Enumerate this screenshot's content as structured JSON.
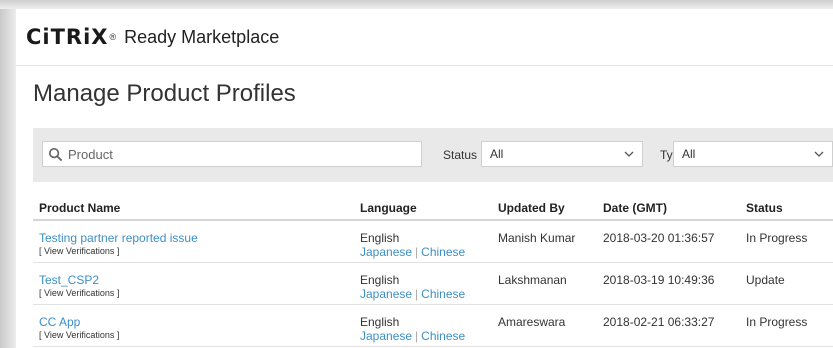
{
  "brand": {
    "logo_mark": "CiTRiX",
    "logo_sup": "®",
    "product": "Ready Marketplace"
  },
  "page": {
    "title": "Manage Product Profiles"
  },
  "filters": {
    "search_placeholder": "Product",
    "status_label": "Status",
    "status_value": "All",
    "type_label": "Type",
    "type_value": "All"
  },
  "table": {
    "headers": [
      "Product Name",
      "Language",
      "Updated By",
      "Date (GMT)",
      "Status"
    ],
    "rows": [
      {
        "name": "Testing partner reported issue",
        "verify": "[ View Verifications ]",
        "language": "English",
        "alt1": "Japanese",
        "alt2": "Chinese",
        "updated_by": "Manish Kumar",
        "date": "2018-03-20 01:36:57",
        "status": "In Progress"
      },
      {
        "name": "Test_CSP2",
        "verify": "[ View Verifications ]",
        "language": "English",
        "alt1": "Japanese",
        "alt2": "Chinese",
        "updated_by": "Lakshmanan",
        "date": "2018-03-19 10:49:36",
        "status": "Update"
      },
      {
        "name": "CC App",
        "verify": "[ View Verifications ]",
        "language": "English",
        "alt1": "Japanese",
        "alt2": "Chinese",
        "updated_by": "Amareswara",
        "date": "2018-02-21 06:33:27",
        "status": "In Progress"
      }
    ]
  },
  "colors": {
    "link": "#3d8fc7",
    "filter_bar": "#e9e9e9",
    "text": "#333333"
  },
  "icons": {
    "search": "search-icon",
    "dropdown": "chevron-down-icon"
  }
}
